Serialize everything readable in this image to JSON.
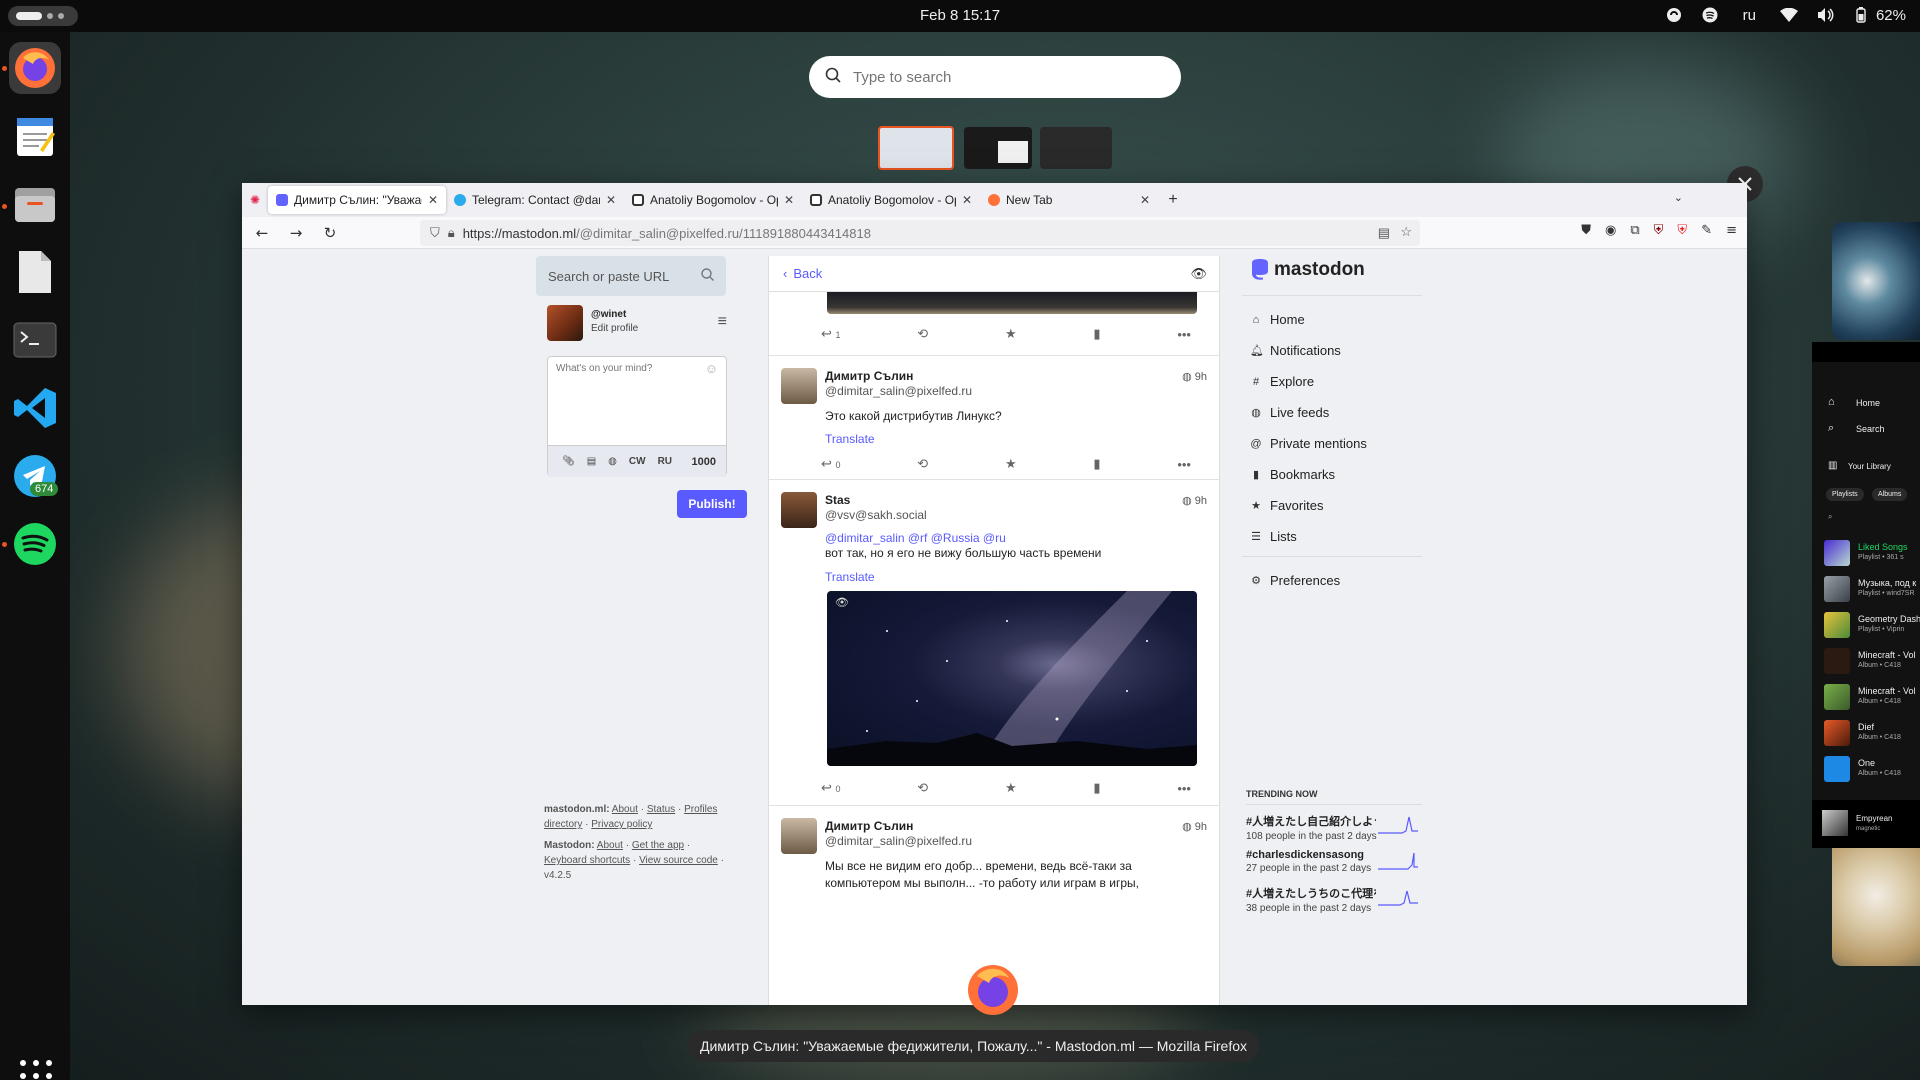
{
  "topbar": {
    "clock": "Feb 8  15:17",
    "lang": "ru",
    "battery": "62%"
  },
  "dock": {
    "telegram_badge": "674"
  },
  "overview": {
    "search_placeholder": "Type to search",
    "window_title": "Димитр Сълин: \"Уважаемые федижители, Пожалу...\" - Mastodon.ml — Mozilla Firefox"
  },
  "browser": {
    "tabs": [
      {
        "label": "Димитр Сълин: \"Уважаемые",
        "color": "#6364ff"
      },
      {
        "label": "Telegram: Contact @dani",
        "color": "#2aabee"
      },
      {
        "label": "Anatoliy Bogomolov - Op",
        "color": "#333"
      },
      {
        "label": "Anatoliy Bogomolov - Op",
        "color": "#333"
      },
      {
        "label": "New Tab",
        "color": "#ff7139"
      }
    ],
    "url_host": "https://mastodon.ml",
    "url_path": "/@dimitar_salin@pixelfed.ru/111891880443414818"
  },
  "left": {
    "search_placeholder": "Search or paste URL",
    "account_handle": "@winet",
    "edit_profile": "Edit profile",
    "compose_placeholder": "What's on your mind?",
    "cw": "CW",
    "lang": "RU",
    "char_count": "1000",
    "publish": "Publish!",
    "footer": {
      "server": "mastodon.ml:",
      "about": "About",
      "status": "Status",
      "profiles_directory": "Profiles directory",
      "privacy": "Privacy policy",
      "mastodon": "Mastodon:",
      "about2": "About",
      "get_app": "Get the app",
      "keyboard": "Keyboard shortcuts",
      "source": "View source code",
      "version": "v4.2.5"
    }
  },
  "column": {
    "back": "Back",
    "top_replies": "1",
    "statuses": [
      {
        "name": "Димитр Сълин",
        "acct": "@dimitar_salin@pixelfed.ru",
        "time": "9h",
        "text": "Это какой дистрибутив Линукс?",
        "translate": "Translate",
        "replies": "0"
      },
      {
        "name": "Stas",
        "acct": "@vsv@sakh.social",
        "time": "9h",
        "mentions": "@dimitar_salin @rf @Russia @ru",
        "text": "вот так, но я его не вижу большую часть времени",
        "translate": "Translate",
        "replies": "0"
      },
      {
        "name": "Димитр Сълин",
        "acct": "@dimitar_salin@pixelfed.ru",
        "time": "9h",
        "text": "Мы все не видим его добр... времени, ведь всё-таки за компьютером мы выполн... -то работу или играм в игры,"
      }
    ]
  },
  "nav": {
    "logo": "mastodon",
    "items": [
      "Home",
      "Notifications",
      "Explore",
      "Live feeds",
      "Private mentions",
      "Bookmarks",
      "Favorites",
      "Lists"
    ],
    "preferences": "Preferences"
  },
  "trending": {
    "title": "TRENDING NOW",
    "items": [
      {
        "tag": "#人増えたし自己紹介しようぜ",
        "sub": "108 people in the past 2 days"
      },
      {
        "tag": "#charlesdickensasong",
        "sub": "27 people in the past 2 days"
      },
      {
        "tag": "#人増えたしうちのこ代理を自...",
        "sub": "38 people in the past 2 days"
      }
    ]
  },
  "spotify": {
    "home": "Home",
    "search": "Search",
    "library": "Your Library",
    "chip1": "Playlists",
    "chip2": "Albums",
    "rows": [
      {
        "title": "Liked Songs",
        "sub": "Playlist • 361 s"
      },
      {
        "title": "Музыка, под к",
        "sub": "Playlist • wind7SR"
      },
      {
        "title": "Geometry Dash",
        "sub": "Playlist • Viprin"
      },
      {
        "title": "Minecraft - Vol",
        "sub": "Album • C418"
      },
      {
        "title": "Minecraft - Vol",
        "sub": "Album • C418"
      },
      {
        "title": "Dief",
        "sub": "Album • C418"
      },
      {
        "title": "One",
        "sub": "Album • C418"
      }
    ],
    "now_playing": "Empyrean",
    "now_artist": "magnetic"
  }
}
